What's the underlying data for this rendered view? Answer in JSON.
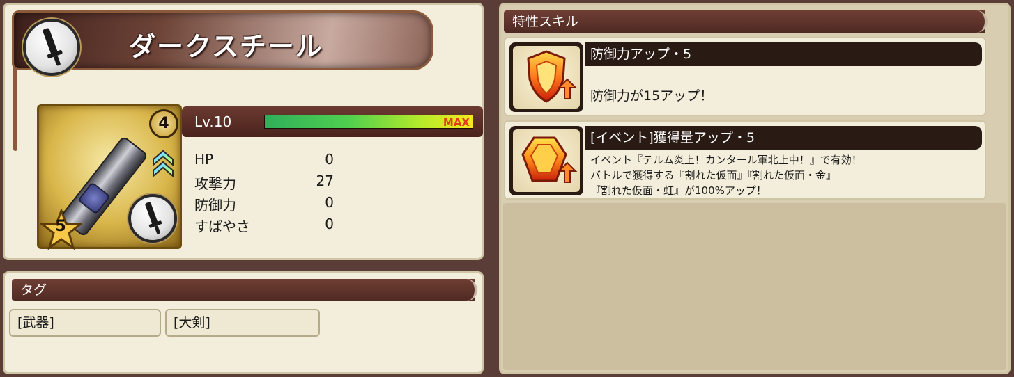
{
  "item": {
    "name": "ダークスチール",
    "rank": "4",
    "stars": "5"
  },
  "level": {
    "label": "Lv.10",
    "max_label": "MAX",
    "progress_percent": 100
  },
  "stats": [
    {
      "name": "HP",
      "value": "0"
    },
    {
      "name": "攻撃力",
      "value": "27"
    },
    {
      "name": "防御力",
      "value": "0"
    },
    {
      "name": "すばやさ",
      "value": "0"
    }
  ],
  "tags": {
    "header": "タグ",
    "items": [
      "[武器]",
      "[大剣]"
    ]
  },
  "skills": {
    "header": "特性スキル",
    "items": [
      {
        "title": "防御力アップ・5",
        "description_lines": [
          "防御力が15アップ！"
        ],
        "icon": "shield-up-icon"
      },
      {
        "title": "[イベント]獲得量アップ・5",
        "description_lines": [
          "イベント『テルム炎上！カンタール軍北上中！』で有効！",
          "バトルで獲得する『割れた仮面』『割れた仮面・金』",
          "『割れた仮面・虹』が100%アップ！"
        ],
        "icon": "gem-up-icon"
      }
    ]
  },
  "colors": {
    "header_bg": "#5a3028",
    "panel_bg": "#f3eedb",
    "max_text": "#e33a1e",
    "exp_gradient_start": "#2fae5a",
    "exp_gradient_end": "#f3e81e"
  }
}
